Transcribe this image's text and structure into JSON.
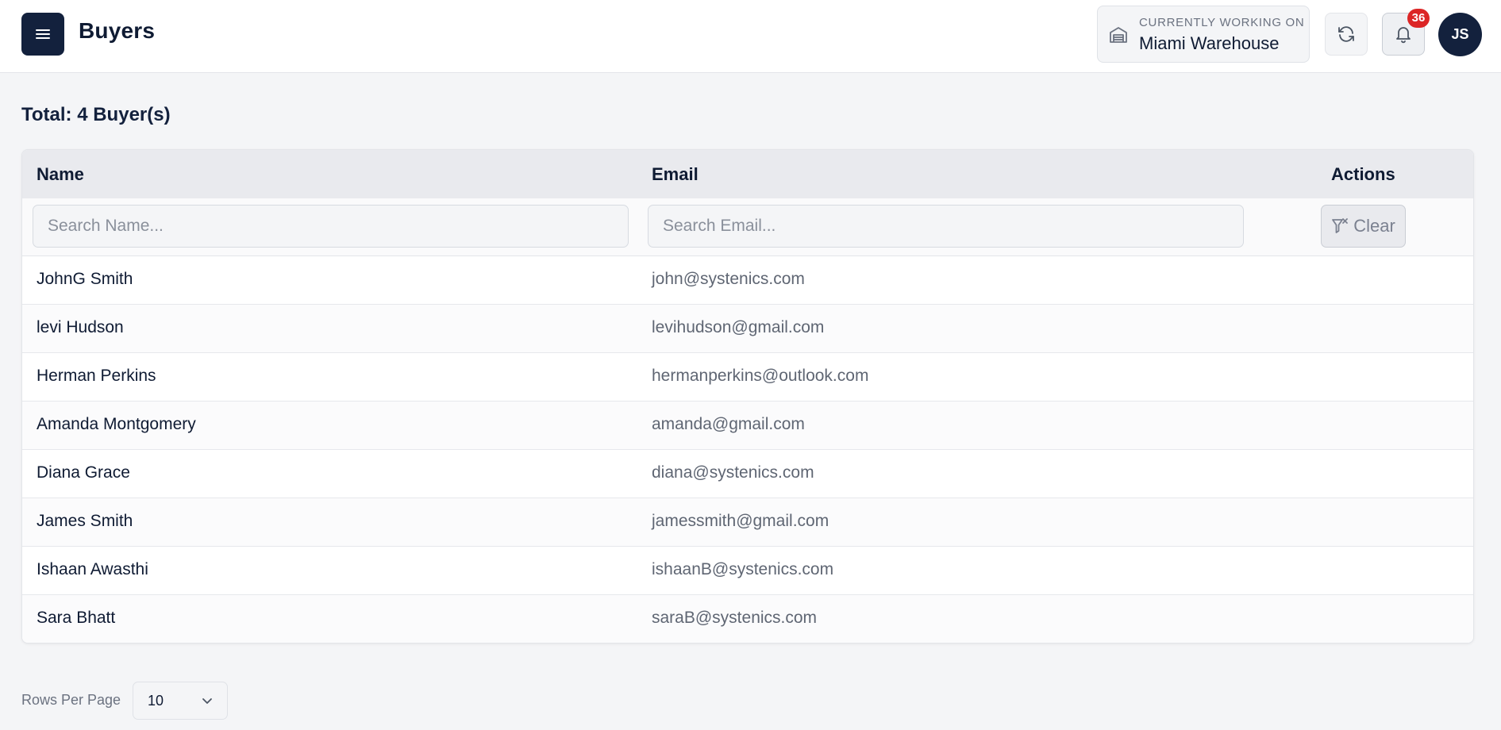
{
  "header": {
    "title": "Buyers",
    "menu_icon": "hamburger-icon",
    "working_on": {
      "caption": "CURRENTLY WORKING ON",
      "name": "Miami Warehouse",
      "icon": "warehouse-icon"
    },
    "refresh_icon": "refresh-icon",
    "notifications": {
      "icon": "bell-icon",
      "count": "36"
    },
    "avatar_initials": "JS"
  },
  "summary": {
    "total_label": "Total: 4 Buyer(s)"
  },
  "table": {
    "columns": {
      "name": "Name",
      "email": "Email",
      "actions": "Actions"
    },
    "filters": {
      "name_placeholder": "Search Name...",
      "email_placeholder": "Search Email...",
      "clear_label": "Clear",
      "clear_icon": "filter-x-icon"
    },
    "rows": [
      {
        "name": "JohnG Smith",
        "email": "john@systenics.com"
      },
      {
        "name": "levi Hudson",
        "email": "levihudson@gmail.com"
      },
      {
        "name": "Herman Perkins",
        "email": "hermanperkins@outlook.com"
      },
      {
        "name": "Amanda Montgomery",
        "email": "amanda@gmail.com"
      },
      {
        "name": "Diana Grace",
        "email": "diana@systenics.com"
      },
      {
        "name": "James Smith",
        "email": "jamessmith@gmail.com"
      },
      {
        "name": "Ishaan Awasthi",
        "email": "ishaanB@systenics.com"
      },
      {
        "name": "Sara Bhatt",
        "email": "saraB@systenics.com"
      }
    ]
  },
  "pagination": {
    "rows_per_page_label": "Rows Per Page",
    "rows_per_page_value": "10"
  },
  "colors": {
    "primary": "#13213d",
    "badge": "#dc2626",
    "background": "#f4f5f7"
  }
}
